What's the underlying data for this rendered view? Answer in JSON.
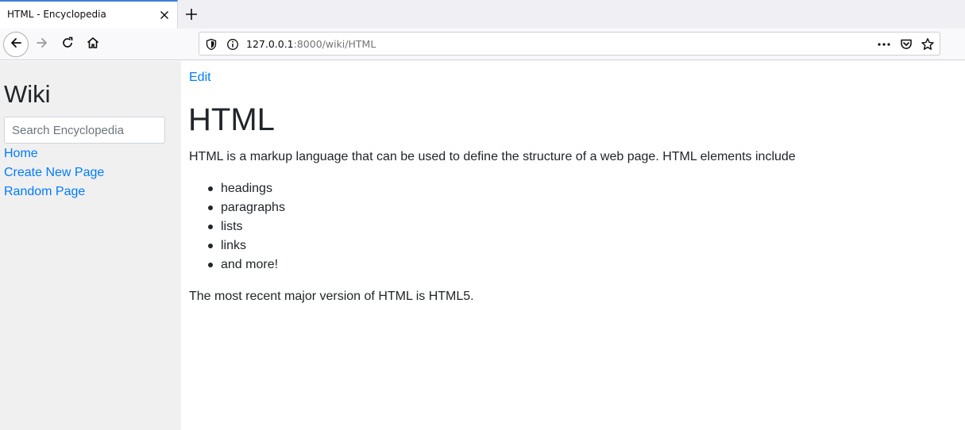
{
  "browser": {
    "tab_title": "HTML - Encyclopedia",
    "url_host": "127.0.0.1",
    "url_rest": ":8000/wiki/HTML",
    "icons": [
      "close-icon",
      "plus-icon",
      "back-arrow-icon",
      "forward-arrow-icon",
      "reload-icon",
      "home-icon",
      "shield-icon",
      "info-icon",
      "more-icon",
      "pocket-icon",
      "star-icon"
    ]
  },
  "sidebar": {
    "title": "Wiki",
    "search_placeholder": "Search Encyclopedia",
    "links": [
      {
        "label": "Home"
      },
      {
        "label": "Create New Page"
      },
      {
        "label": "Random Page"
      }
    ]
  },
  "main": {
    "edit_label": "Edit",
    "title": "HTML",
    "intro": "HTML is a markup language that can be used to define the structure of a web page. HTML elements include",
    "elements": [
      "headings",
      "paragraphs",
      "lists",
      "links",
      "and more!"
    ],
    "outro": "The most recent major version of HTML is HTML5."
  },
  "colors": {
    "link": "#007bff",
    "sidebar_bg": "#f0f0f0",
    "text": "#212529",
    "tab_accent": "#3b7ed6"
  }
}
